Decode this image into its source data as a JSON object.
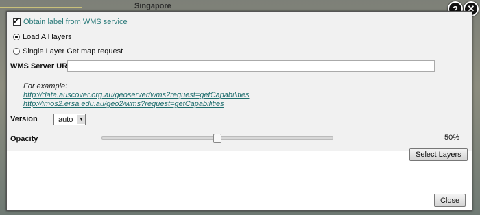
{
  "map": {
    "place_label": "Singapore"
  },
  "header_icons": {
    "help": "help-icon",
    "close": "close-icon"
  },
  "form": {
    "obtain_label": "Obtain label from WMS service",
    "load_all_layers": "Load All layers",
    "single_layer": "Single Layer Get map request",
    "server_url_label": "WMS Server URL",
    "server_url_value": "",
    "example_label": "For example:",
    "example_links": [
      "http://data.auscover.org.au/geoserver/wms?request=getCapabilities",
      "http://imos2.ersa.edu.au/geo2/wms?request=getCapabilities"
    ],
    "version_label": "Version",
    "version_value": "auto",
    "opacity_label": "Opacity",
    "opacity_value": 0.5,
    "opacity_text": "50%"
  },
  "buttons": {
    "select_layers": "Select Layers",
    "close": "Close"
  },
  "colors": {
    "link": "#1f6e6e",
    "panel": "#f1f1f1"
  }
}
